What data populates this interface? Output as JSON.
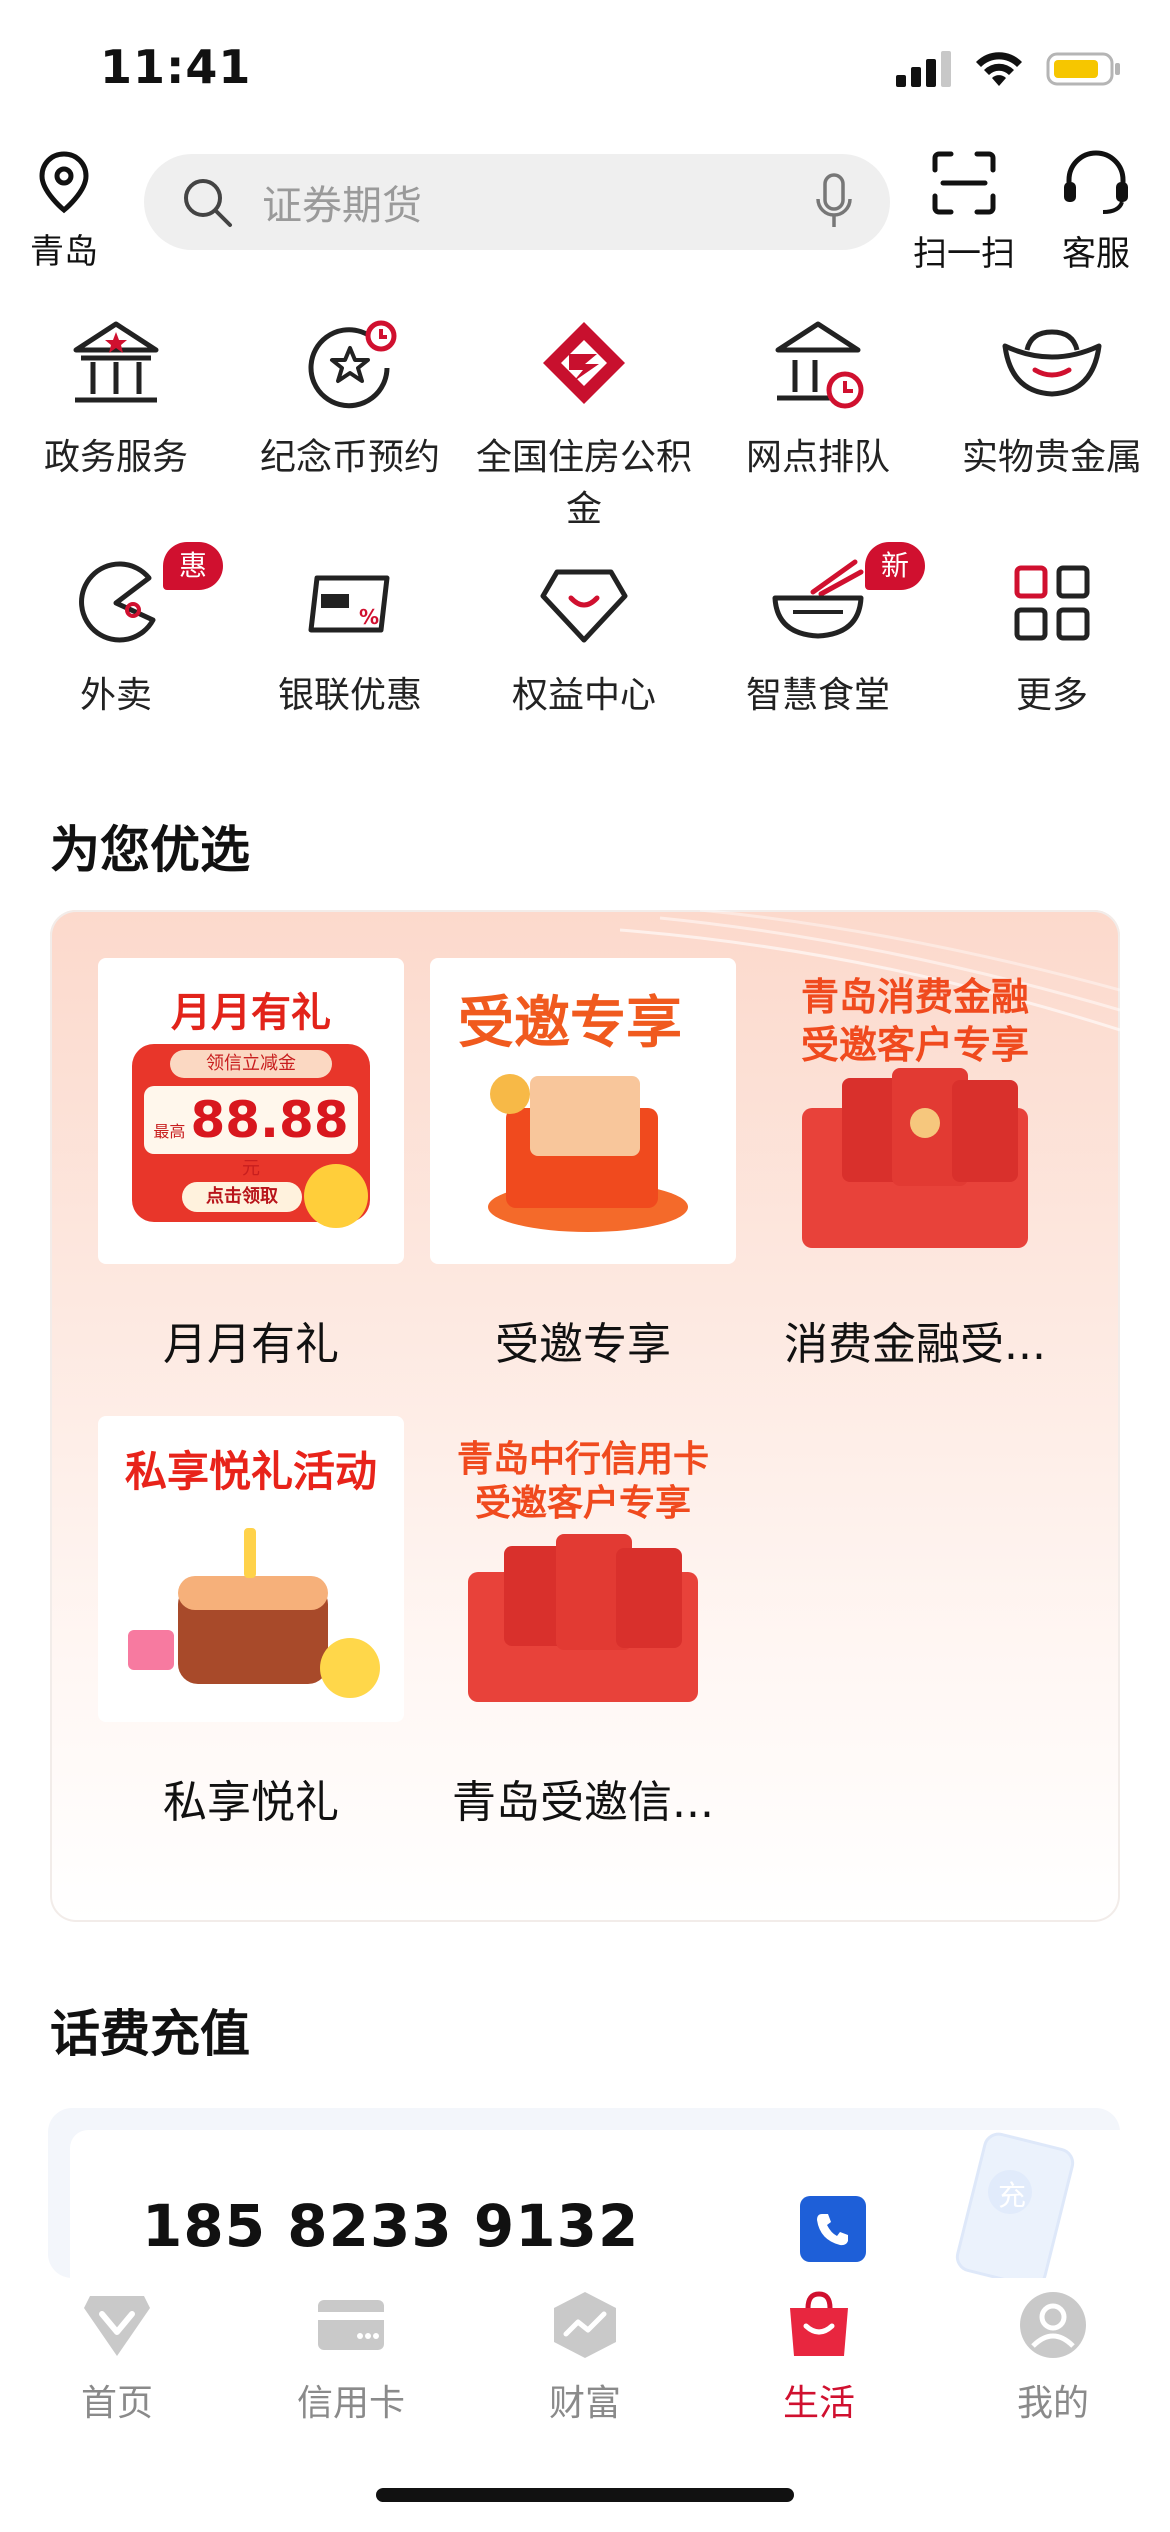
{
  "status": {
    "time": "11:41"
  },
  "header": {
    "location": "青岛",
    "search_placeholder": "证券期货",
    "scan_label": "扫一扫",
    "service_label": "客服"
  },
  "services": [
    {
      "label": "政务服务",
      "icon": "government-building-icon"
    },
    {
      "label": "纪念币预约",
      "icon": "commemorative-coin-icon"
    },
    {
      "label": "全国住房公积金",
      "icon": "housing-fund-icon"
    },
    {
      "label": "网点排队",
      "icon": "branch-queue-icon"
    },
    {
      "label": "实物贵金属",
      "icon": "gold-ingot-icon"
    },
    {
      "label": "外卖",
      "icon": "takeout-icon",
      "badge": "惠"
    },
    {
      "label": "银联优惠",
      "icon": "unionpay-card-icon"
    },
    {
      "label": "权益中心",
      "icon": "diamond-icon"
    },
    {
      "label": "智慧食堂",
      "icon": "noodle-bowl-icon",
      "badge": "新"
    },
    {
      "label": "更多",
      "icon": "more-grid-icon"
    }
  ],
  "recommend": {
    "title": "为您优选",
    "tiles": [
      {
        "caption": "月月有礼",
        "art_title": "月月有礼",
        "art_sub": "领信立减金",
        "art_amount": "88.88",
        "art_amount_prefix": "最高",
        "art_unit": "元",
        "art_button": "点击领取"
      },
      {
        "caption": "受邀专享",
        "art_title": "受邀专享"
      },
      {
        "caption": "消费金融受...",
        "art_title_1": "青岛消费金融",
        "art_title_2": "受邀客户专享"
      },
      {
        "caption": "私享悦礼",
        "art_title": "私享悦礼活动"
      },
      {
        "caption": "青岛受邀信...",
        "art_title_1": "青岛中行信用卡",
        "art_title_2": "受邀客户专享"
      }
    ]
  },
  "recharge": {
    "title": "话费充值",
    "phone": "185 8233 9132",
    "watermark_char": "充"
  },
  "tabs": [
    {
      "label": "首页",
      "icon": "home-icon"
    },
    {
      "label": "信用卡",
      "icon": "credit-card-icon"
    },
    {
      "label": "财富",
      "icon": "wealth-icon"
    },
    {
      "label": "生活",
      "icon": "life-bag-icon",
      "active": true
    },
    {
      "label": "我的",
      "icon": "profile-icon"
    }
  ],
  "colors": {
    "accent": "#d0102f",
    "promo_red": "#e2231a",
    "tab_inactive": "#8a8a8a"
  }
}
